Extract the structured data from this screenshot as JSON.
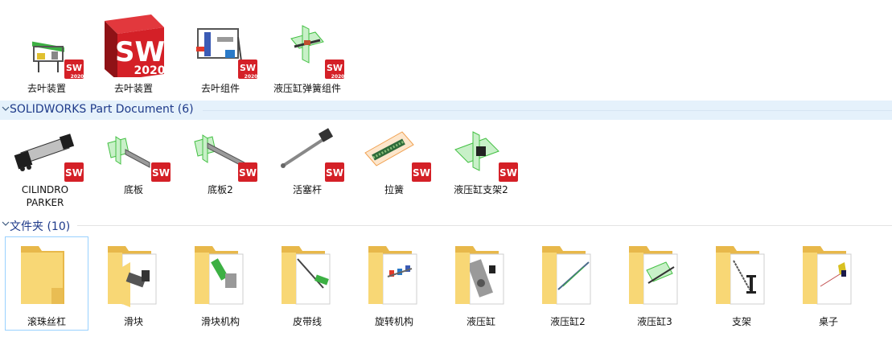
{
  "assemblies": [
    {
      "name": "去叶装置"
    },
    {
      "name": "去叶装置"
    },
    {
      "name": "去叶组件"
    },
    {
      "name": "液压缸弹簧组件"
    }
  ],
  "sw_logo": {
    "letters": "SW",
    "year": "2020",
    "badge_year": "2020"
  },
  "groups": [
    {
      "title": "SOLIDWORKS Part Document (6)"
    },
    {
      "title": "文件夹 (10)"
    }
  ],
  "parts": [
    {
      "name": "CILINDRO\nPARKER"
    },
    {
      "name": "底板"
    },
    {
      "name": "底板2"
    },
    {
      "name": "活塞杆"
    },
    {
      "name": "拉簧"
    },
    {
      "name": "液压缸支架2"
    }
  ],
  "folders": [
    {
      "name": "滚珠丝杠"
    },
    {
      "name": "滑块"
    },
    {
      "name": "滑块机构"
    },
    {
      "name": "皮带线"
    },
    {
      "name": "旋转机构"
    },
    {
      "name": "液压缸"
    },
    {
      "name": "液压缸2"
    },
    {
      "name": "液压缸3"
    },
    {
      "name": "支架"
    },
    {
      "name": "桌子"
    }
  ],
  "colors": {
    "header_bg": "#e5f1fb",
    "header_text": "#1e3a8a",
    "selection_border": "#99d1ff",
    "sw_red": "#d42027",
    "folder": "#f8d775"
  }
}
